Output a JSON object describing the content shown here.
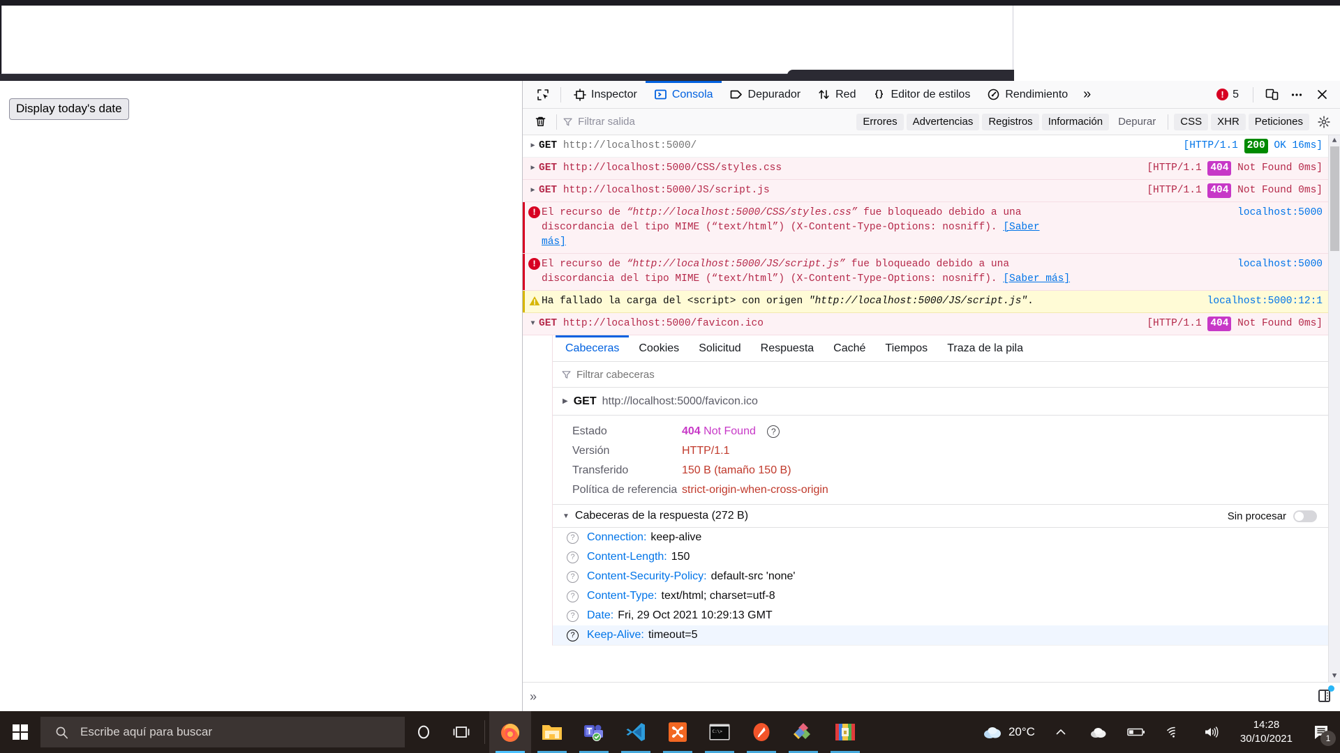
{
  "page": {
    "button_label": "Display today's date"
  },
  "devtools": {
    "tabs": [
      {
        "label": "",
        "icon": "element-picker-icon",
        "active": false
      },
      {
        "label": "Inspector",
        "icon": "inspector-icon",
        "active": false
      },
      {
        "label": "Consola",
        "icon": "console-icon",
        "active": true
      },
      {
        "label": "Depurador",
        "icon": "debugger-icon",
        "active": false
      },
      {
        "label": "Red",
        "icon": "network-icon",
        "active": false
      },
      {
        "label": "Editor de estilos",
        "icon": "style-editor-icon",
        "active": false
      },
      {
        "label": "Rendimiento",
        "icon": "performance-icon",
        "active": false
      }
    ],
    "overflow_label": "»",
    "error_count": "5",
    "toolbar_icons": [
      "responsive-design-mode-icon",
      "meatball-menu-icon",
      "close-icon"
    ],
    "filterbar": {
      "clear_icon": "trash-icon",
      "filter_placeholder": "Filtrar salida",
      "filter_value": "",
      "pills": [
        {
          "label": "Errores",
          "on": true
        },
        {
          "label": "Advertencias",
          "on": true
        },
        {
          "label": "Registros",
          "on": true
        },
        {
          "label": "Información",
          "on": true
        },
        {
          "label": "Depurar",
          "on": false
        }
      ],
      "pills_right": [
        {
          "label": "CSS",
          "on": true
        },
        {
          "label": "XHR",
          "on": true
        },
        {
          "label": "Peticiones",
          "on": true
        }
      ],
      "settings_icon": "gear-icon"
    },
    "messages": [
      {
        "kind": "network",
        "severity": "none",
        "twisty": "▶",
        "method": "GET",
        "url": "http://localhost:5000/",
        "status_prefix": "[HTTP/1.1",
        "status_code": "200",
        "status_text": "OK 16ms]",
        "status_kind": "ok"
      },
      {
        "kind": "network",
        "severity": "error",
        "twisty": "▶",
        "method": "GET",
        "url": "http://localhost:5000/CSS/styles.css",
        "status_prefix": "[HTTP/1.1",
        "status_code": "404",
        "status_text": "Not Found 0ms]",
        "status_kind": "err"
      },
      {
        "kind": "network",
        "severity": "error",
        "twisty": "▶",
        "method": "GET",
        "url": "http://localhost:5000/JS/script.js",
        "status_prefix": "[HTTP/1.1",
        "status_code": "404",
        "status_text": "Not Found 0ms]",
        "status_kind": "err"
      },
      {
        "kind": "error",
        "severity": "error",
        "text_1": "El recurso de ",
        "quoted_1": "“http://localhost:5000/CSS/styles.css”",
        "text_2": " fue bloqueado debido a una discordancia del tipo MIME (“text/html”) (X-Content-Type-Options: nosniff). ",
        "learn_more": "[Saber más]",
        "source": "localhost:5000"
      },
      {
        "kind": "error",
        "severity": "error",
        "text_1": "El recurso de ",
        "quoted_1": "“http://localhost:5000/JS/script.js”",
        "text_2": " fue bloqueado debido a una discordancia del tipo MIME (“text/html”) (X-Content-Type-Options: nosniff). ",
        "learn_more": "[Saber más]",
        "source": "localhost:5000"
      },
      {
        "kind": "warning",
        "severity": "warning",
        "text_1": "Ha fallado la carga del <script> con origen ",
        "quoted_1": "\"http://localhost:5000/JS/script.js\"",
        "text_2": ".",
        "source": "localhost:5000:12:1"
      },
      {
        "kind": "network-expanded",
        "severity": "error",
        "twisty": "▼",
        "method": "GET",
        "url": "http://localhost:5000/favicon.ico",
        "status_prefix": "[HTTP/1.1",
        "status_code": "404",
        "status_text": "Not Found 0ms]",
        "status_kind": "err"
      }
    ],
    "net_panel": {
      "tabs": [
        {
          "label": "Cabeceras",
          "active": true
        },
        {
          "label": "Cookies",
          "active": false
        },
        {
          "label": "Solicitud",
          "active": false
        },
        {
          "label": "Respuesta",
          "active": false
        },
        {
          "label": "Caché",
          "active": false
        },
        {
          "label": "Tiempos",
          "active": false
        },
        {
          "label": "Traza de la pila",
          "active": false
        }
      ],
      "filter_placeholder": "Filtrar cabeceras",
      "filter_value": "",
      "request_method": "GET",
      "request_url": "http://localhost:5000/favicon.ico",
      "summary": [
        {
          "label": "Estado",
          "code": "404",
          "value": "Not Found",
          "help": true
        },
        {
          "label": "Versión",
          "code": "",
          "value": "HTTP/1.1",
          "help": false
        },
        {
          "label": "Transferido",
          "code": "",
          "value": "150 B (tamaño 150 B)",
          "help": false
        },
        {
          "label": "Política de referencia",
          "code": "",
          "value": "strict-origin-when-cross-origin",
          "help": false
        }
      ],
      "section_title": "Cabeceras de la respuesta (272 B)",
      "raw_label": "Sin procesar",
      "raw_enabled": false,
      "headers": [
        {
          "name": "Connection:",
          "value": "keep-alive",
          "highlight": false
        },
        {
          "name": "Content-Length:",
          "value": "150",
          "highlight": false
        },
        {
          "name": "Content-Security-Policy:",
          "value": "default-src 'none'",
          "highlight": false
        },
        {
          "name": "Content-Type:",
          "value": "text/html; charset=utf-8",
          "highlight": false
        },
        {
          "name": "Date:",
          "value": "Fri, 29 Oct 2021 10:29:13 GMT",
          "highlight": false
        },
        {
          "name": "Keep-Alive:",
          "value": "timeout=5",
          "highlight": true
        }
      ]
    },
    "eval_bar": {
      "prompt": "»",
      "value": "",
      "split_console_icon": "split-console-icon"
    }
  },
  "taskbar": {
    "start_icon": "windows-start-icon",
    "search_placeholder": "Escribe aquí para buscar",
    "cortana_icon": "cortana-icon",
    "taskview_icon": "task-view-icon",
    "apps": [
      {
        "name": "firefox-icon",
        "active": true
      },
      {
        "name": "file-explorer-icon",
        "active": false
      },
      {
        "name": "microsoft-teams-icon",
        "active": false
      },
      {
        "name": "vs-code-icon",
        "active": false
      },
      {
        "name": "xampp-icon",
        "active": false
      },
      {
        "name": "command-prompt-icon",
        "active": false
      },
      {
        "name": "postman-icon",
        "active": false
      },
      {
        "name": "figma-icon",
        "active": false
      },
      {
        "name": "winrar-icon",
        "active": false
      }
    ],
    "weather_temp": "20°C",
    "weather_icon": "cloud-icon",
    "tray_icons": [
      "show-hidden-icons-chevron",
      "onedrive-icon",
      "battery-icon",
      "wifi-icon",
      "volume-icon"
    ],
    "time": "14:28",
    "date": "30/10/2021",
    "action_center_icon": "action-center-icon",
    "notification_count": "1"
  },
  "colors": {
    "accent": "#0061e0",
    "error": "#d70022",
    "warning": "#d7b600",
    "status_ok": "#008a00",
    "status_404": "#c738c7",
    "link": "#0074e8",
    "taskbar_bg": "#231c19"
  }
}
